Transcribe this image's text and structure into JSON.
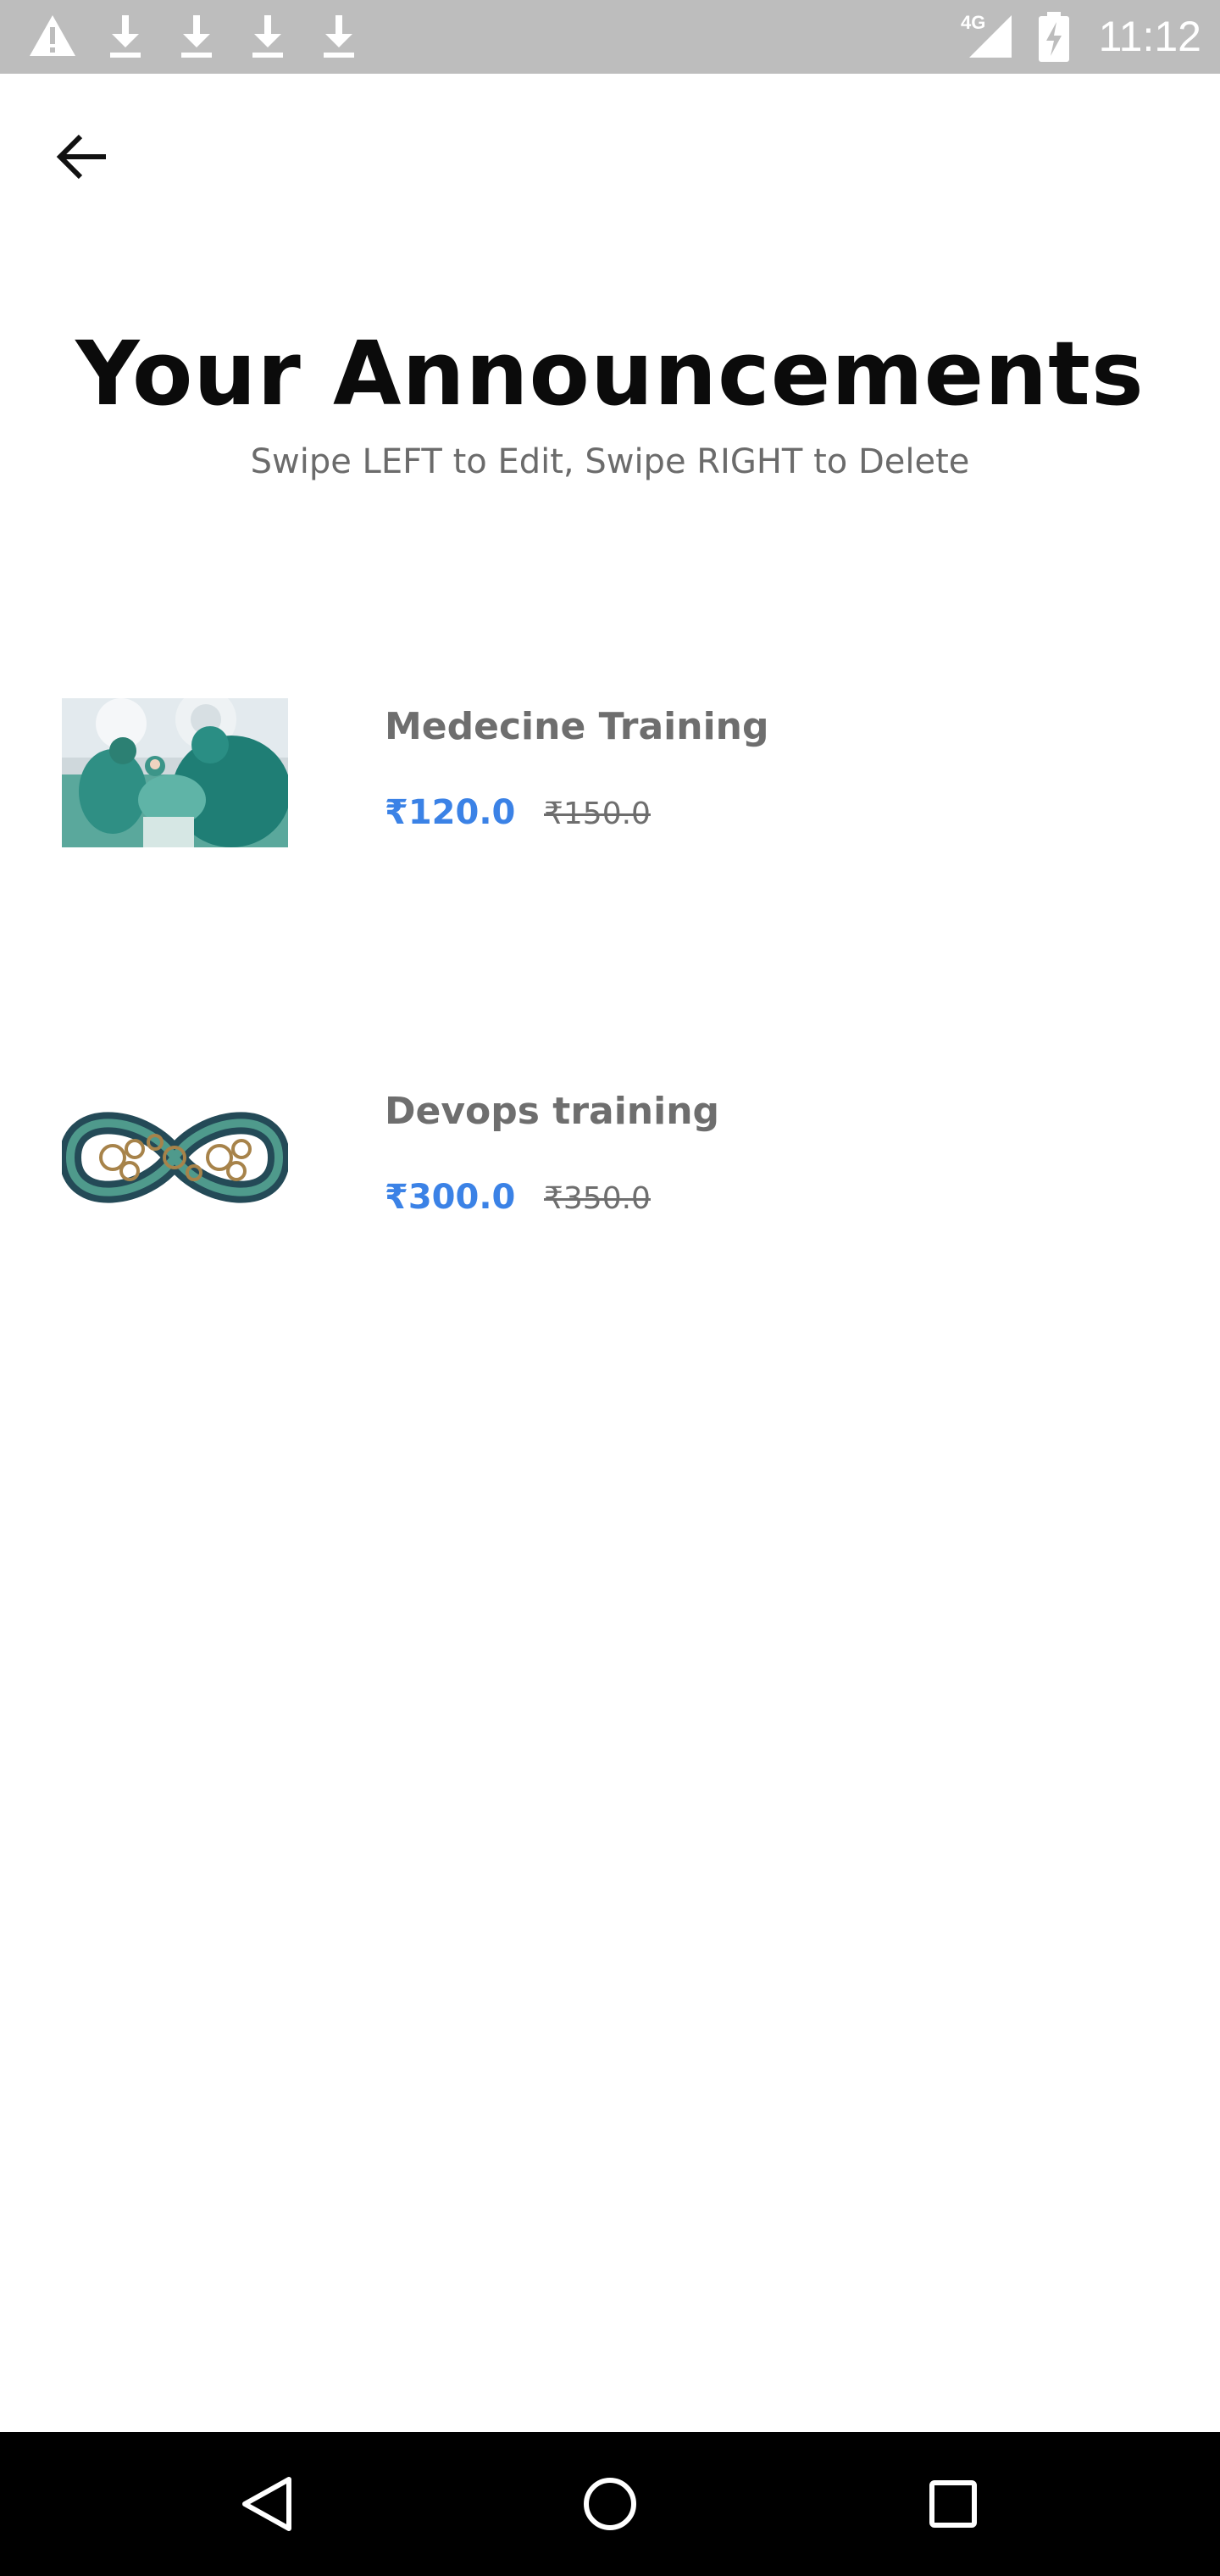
{
  "status_bar": {
    "time": "11:12",
    "icons": [
      "warning-icon",
      "download-icon",
      "download-icon",
      "download-icon",
      "download-icon",
      "signal-4g-icon",
      "battery-charging-icon"
    ],
    "network_label": "4G"
  },
  "header": {
    "back_icon": "arrow-left-icon",
    "title": "Your Announcements",
    "subtitle": "Swipe LEFT to Edit, Swipe RIGHT to Delete"
  },
  "announcements": [
    {
      "title": "Medecine Training",
      "price": "₹120.0",
      "old_price": "₹150.0",
      "image": "surgery-photo"
    },
    {
      "title": "Devops training",
      "price": "₹300.0",
      "old_price": "₹350.0",
      "image": "devops-infinity-logo"
    }
  ],
  "nav_bar": {
    "icons": [
      "back-triangle-icon",
      "home-circle-icon",
      "recents-square-icon"
    ]
  },
  "colors": {
    "status_bar": "#bdbdbd",
    "price": "#3b82e6",
    "muted_text": "#6e6e6e",
    "nav_bar": "#000000"
  }
}
